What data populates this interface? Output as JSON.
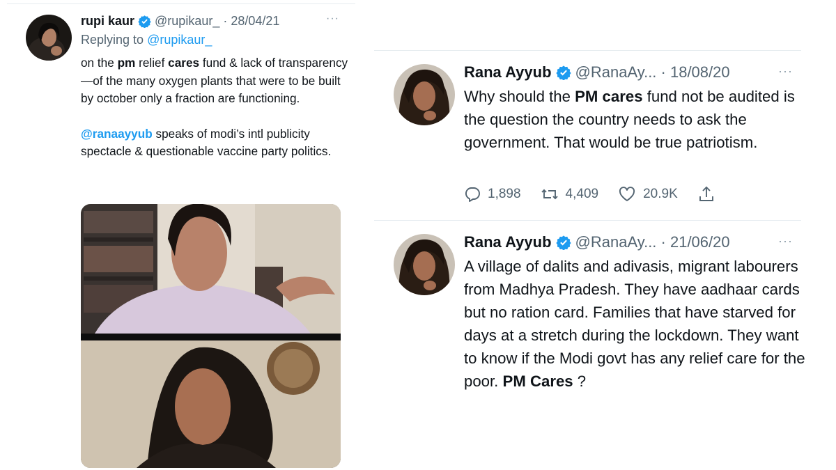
{
  "left_tweet": {
    "author_name": "rupi kaur",
    "handle_date": "@rupikaur_ · 28/04/21",
    "replying_prefix": "Replying to ",
    "replying_handle": "@rupikaur_",
    "p1_a": "on the ",
    "p1_b": "pm",
    "p1_c": " relief ",
    "p1_d": "cares",
    "p1_e": " fund & lack of transparency—of the many oxygen plants that were to be built by october only a fraction are functioning.",
    "p2_mention": "@ranaayyub",
    "p2_rest": " speaks of modi’s intl publicity spectacle & questionable vaccine party politics.",
    "more": "···"
  },
  "tweet1": {
    "author_name": "Rana Ayyub",
    "handle_date": "@RanaAy... · 18/08/20",
    "b_a": "Why should the ",
    "b_b": "PM cares",
    "b_c": " fund not be audited is the question the country needs to ask the government. That would be true patriotism.",
    "replies": "1,898",
    "retweets": "4,409",
    "likes": "20.9K",
    "more": "···"
  },
  "tweet2": {
    "author_name": "Rana Ayyub",
    "handle_date": "@RanaAy... · 21/06/20",
    "b_a": "A village of dalits and adivasis, migrant labourers from Madhya Pradesh. They have aadhaar cards but no ration card. Families that have starved for days at a stretch during the lockdown. They want to know if the Modi govt has any relief care for the poor. ",
    "b_b": "PM Cares",
    "b_c": " ?",
    "more": "···"
  },
  "colors": {
    "accent": "#1d9bf0",
    "secondary_text": "#536471",
    "divider": "#e6ecf0"
  }
}
